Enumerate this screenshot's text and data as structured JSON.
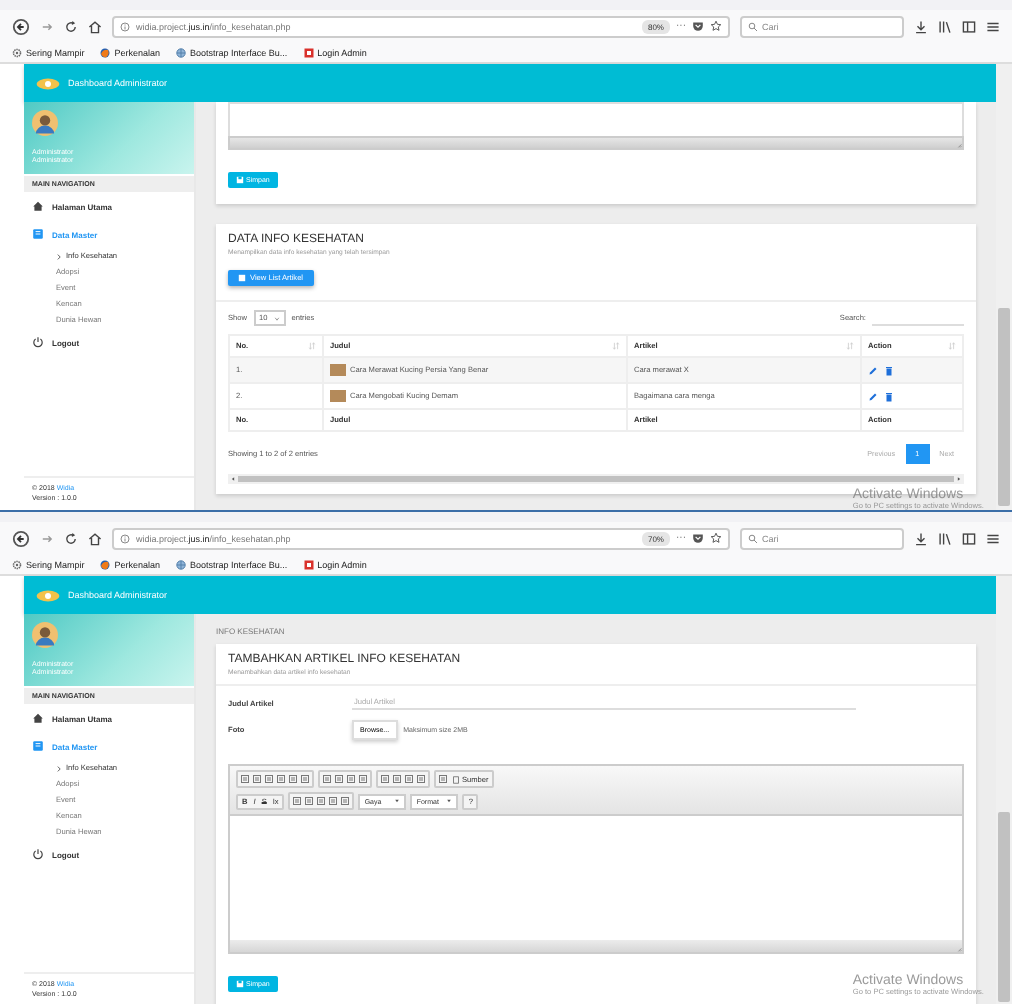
{
  "windows": [
    {
      "kind": "list",
      "toolbar": {
        "url": "widia.project.**jus.in**/info_kesehatan.php",
        "zoom": "80%",
        "more": "···",
        "search_placeholder": "Cari"
      },
      "bookmarks": [
        {
          "label": "Sering Mampir"
        },
        {
          "label": "Perkenalan"
        },
        {
          "label": "Bootstrap Interface Bu..."
        },
        {
          "label": "Login Admin"
        }
      ],
      "header": {
        "title": "Dashboard Administrator"
      },
      "sidebar": {
        "user": "Administrator",
        "role": "Administrator",
        "nav_title": "MAIN NAVIGATION",
        "items": [
          {
            "label": "Halaman Utama",
            "selected": false
          },
          {
            "label": "Data Master",
            "selected": true,
            "children": [
              {
                "label": "Info Kesehatan",
                "selected": true
              },
              {
                "label": "Adopsi",
                "selected": false
              },
              {
                "label": "Event",
                "selected": false
              },
              {
                "label": "Kencan",
                "selected": false
              },
              {
                "label": "Dunia Hewan",
                "selected": false
              }
            ]
          },
          {
            "label": "Logout",
            "selected": false
          }
        ],
        "copyright": "© 2018",
        "brand": "Widia",
        "version": "Version : 1.0.0"
      },
      "content": {
        "save_button": "Simpan",
        "card": {
          "title": "DATA INFO KESEHATAN",
          "subtitle": "Menampilkan data info kesehatan yang telah tersimpan",
          "view_button": "View List Artikel",
          "show": "Show",
          "length": "10",
          "entries": "entries",
          "search_label": "Search:",
          "columns": [
            "No.",
            "Judul",
            "Artikel",
            "Action"
          ],
          "rows": [
            {
              "no": "1.",
              "title": "Cara Merawat Kucing Persia Yang Benar",
              "article": "Cara merawat X"
            },
            {
              "no": "2.",
              "title": "Cara Mengobati Kucing Demam",
              "article": "Bagaimana cara menga"
            }
          ],
          "footer_columns": [
            "No.",
            "Judul",
            "Artikel",
            "Action"
          ],
          "info": "Showing 1 to 2 of 2 entries",
          "pages": [
            {
              "label": "Previous",
              "selected": false,
              "disabled": true
            },
            {
              "label": "1",
              "selected": true,
              "disabled": false
            },
            {
              "label": "Next",
              "selected": false,
              "disabled": true
            }
          ]
        }
      },
      "os_notice": {
        "title": "Activate Windows",
        "text": "Go to PC settings to activate Windows."
      }
    },
    {
      "kind": "form",
      "toolbar": {
        "url": "widia.project.**jus.in**/info_kesehatan.php",
        "zoom": "70%",
        "more": "···",
        "search_placeholder": "Cari"
      },
      "bookmarks": [
        {
          "label": "Sering Mampir"
        },
        {
          "label": "Perkenalan"
        },
        {
          "label": "Bootstrap Interface Bu..."
        },
        {
          "label": "Login Admin"
        }
      ],
      "header": {
        "title": "Dashboard Administrator"
      },
      "sidebar": {
        "user": "Administrator",
        "role": "Administrator",
        "nav_title": "MAIN NAVIGATION",
        "items": [
          {
            "label": "Halaman Utama",
            "selected": false
          },
          {
            "label": "Data Master",
            "selected": true,
            "children": [
              {
                "label": "Info Kesehatan",
                "selected": true
              },
              {
                "label": "Adopsi",
                "selected": false
              },
              {
                "label": "Event",
                "selected": false
              },
              {
                "label": "Kencan",
                "selected": false
              },
              {
                "label": "Dunia Hewan",
                "selected": false
              }
            ]
          },
          {
            "label": "Logout",
            "selected": false
          }
        ],
        "copyright": "© 2018",
        "brand": "Widia",
        "version": "Version : 1.0.0"
      },
      "content": {
        "breadcrumb": "INFO KESEHATAN",
        "card": {
          "title": "TAMBAHKAN ARTIKEL INFO KESEHATAN",
          "subtitle": "Menambahkan data artikel info kesehatan",
          "fields": [
            {
              "kind": "text",
              "label": "Judul Artikel",
              "placeholder": "Judul Artikel"
            },
            {
              "kind": "file",
              "label": "Foto",
              "button": "Browse...",
              "hint": "Maksimum size 2MB"
            }
          ],
          "editor": {
            "source_button": "Sumber",
            "format_buttons": [
              "B",
              "I",
              "S",
              "Ix"
            ],
            "dropdowns": [
              "Gaya",
              "Format"
            ],
            "help": "?"
          },
          "save_button": "Simpan"
        }
      },
      "os_notice": {
        "title": "Activate Windows",
        "text": "Go to PC settings to activate Windows."
      }
    }
  ]
}
